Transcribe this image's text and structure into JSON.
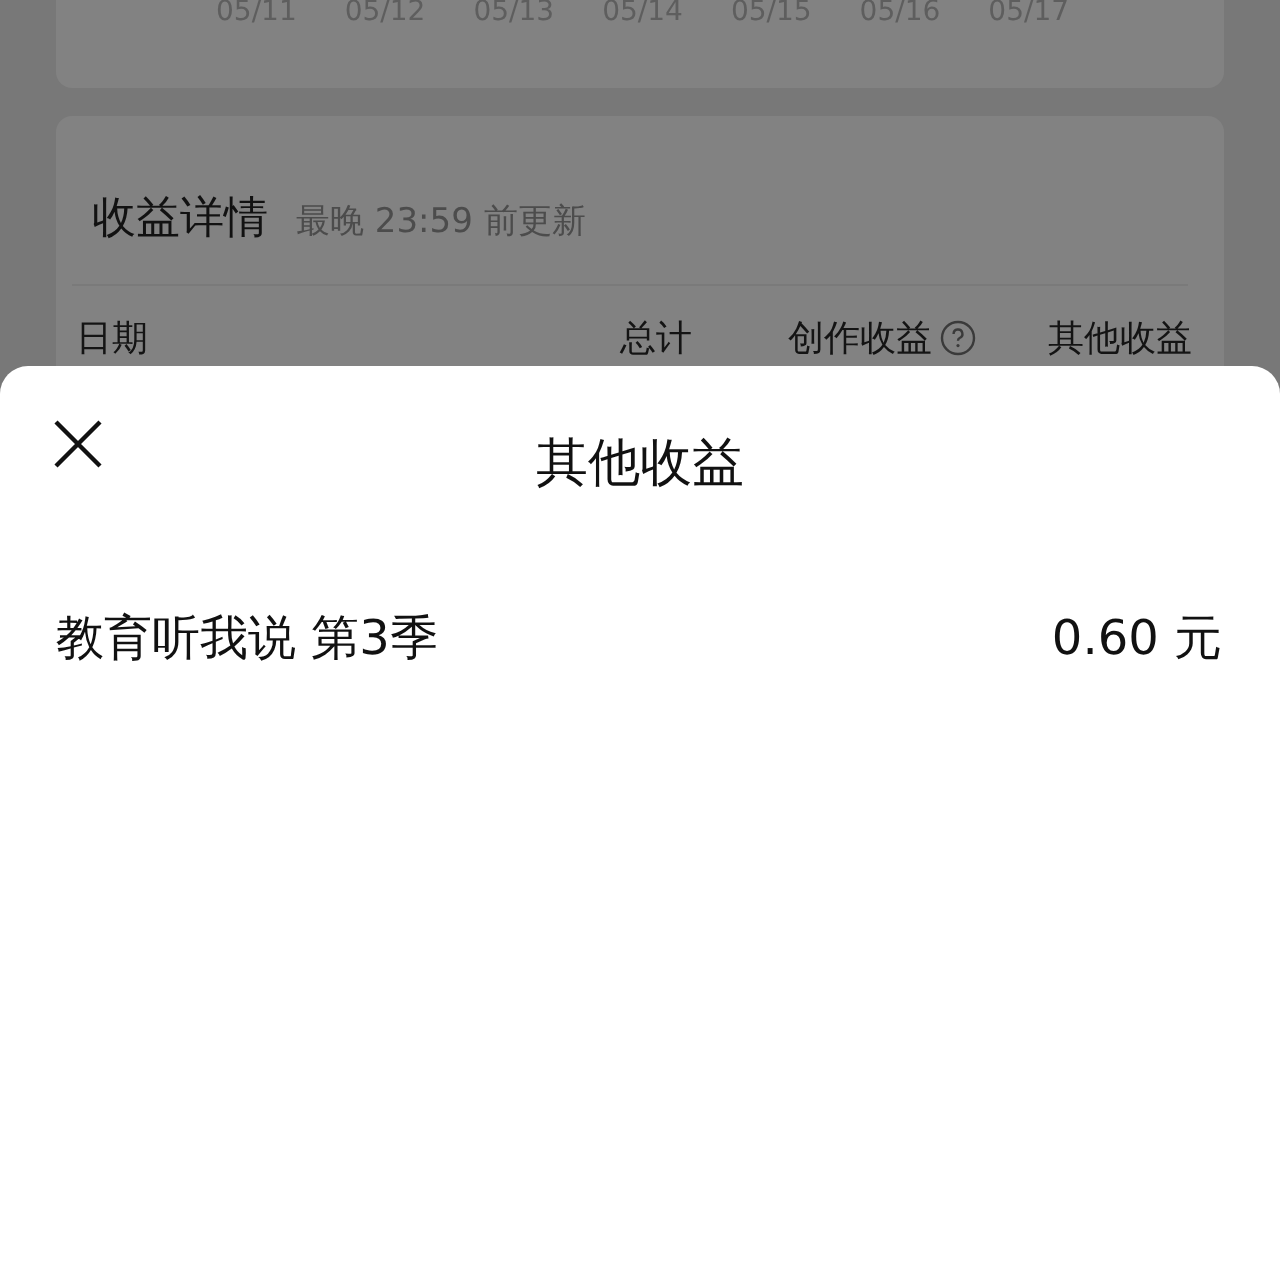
{
  "chart_axis": {
    "dates": [
      "05/11",
      "05/12",
      "05/13",
      "05/14",
      "05/15",
      "05/16",
      "05/17"
    ]
  },
  "earnings_details": {
    "title": "收益详情",
    "note": "最晚 23:59 前更新",
    "columns": [
      {
        "label": "日期",
        "kind": "plain"
      },
      {
        "label": "总计",
        "kind": "plain"
      },
      {
        "label": "创作收益",
        "kind": "help"
      },
      {
        "label": "其他收益",
        "kind": "plain"
      }
    ]
  },
  "sheet": {
    "title": "其他收益",
    "items": [
      {
        "name": "教育听我说 第3季",
        "amount": "0.60 元"
      }
    ]
  }
}
